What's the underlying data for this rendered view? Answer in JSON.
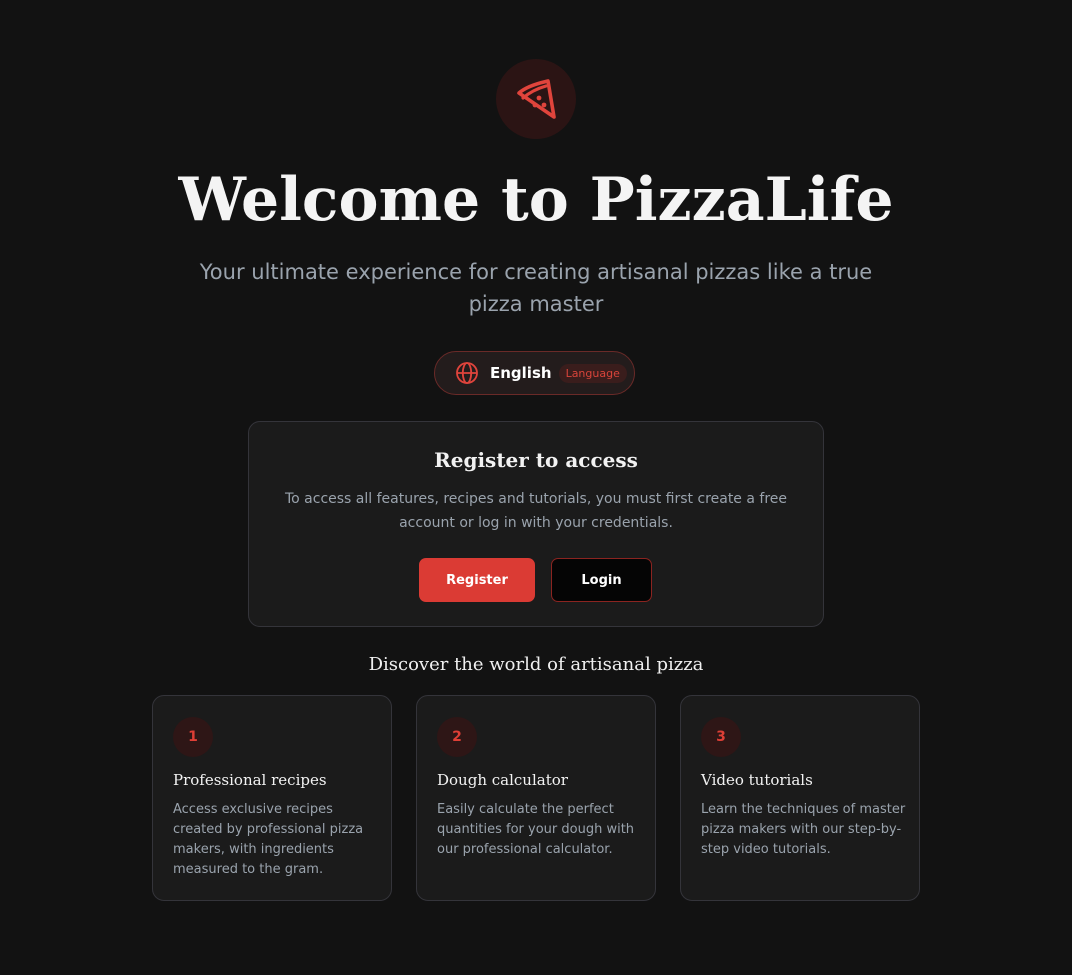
{
  "colors": {
    "background": "#121212",
    "accent": "#db3b34",
    "card": "#1b1b1b",
    "muted_text": "#9aa3ad"
  },
  "logo": {
    "icon": "pizza-slice-icon"
  },
  "hero": {
    "title": "Welcome to PizzaLife",
    "subtitle": "Your ultimate experience for creating artisanal pizzas like a true pizza master"
  },
  "language": {
    "icon": "globe-icon",
    "current": "English",
    "badge": "Language"
  },
  "auth_card": {
    "title": "Register to access",
    "text": "To access all features, recipes and tutorials, you must first create a free account or log in with your credentials.",
    "register_label": "Register",
    "login_label": "Login"
  },
  "features": {
    "section_title": "Discover the world of artisanal pizza",
    "items": [
      {
        "number": "1",
        "title": "Professional recipes",
        "description": "Access exclusive recipes created by professional pizza makers, with ingredients measured to the gram."
      },
      {
        "number": "2",
        "title": "Dough calculator",
        "description": "Easily calculate the perfect quantities for your dough with our professional calculator."
      },
      {
        "number": "3",
        "title": "Video tutorials",
        "description": "Learn the techniques of master pizza makers with our step-by-step video tutorials."
      }
    ]
  }
}
